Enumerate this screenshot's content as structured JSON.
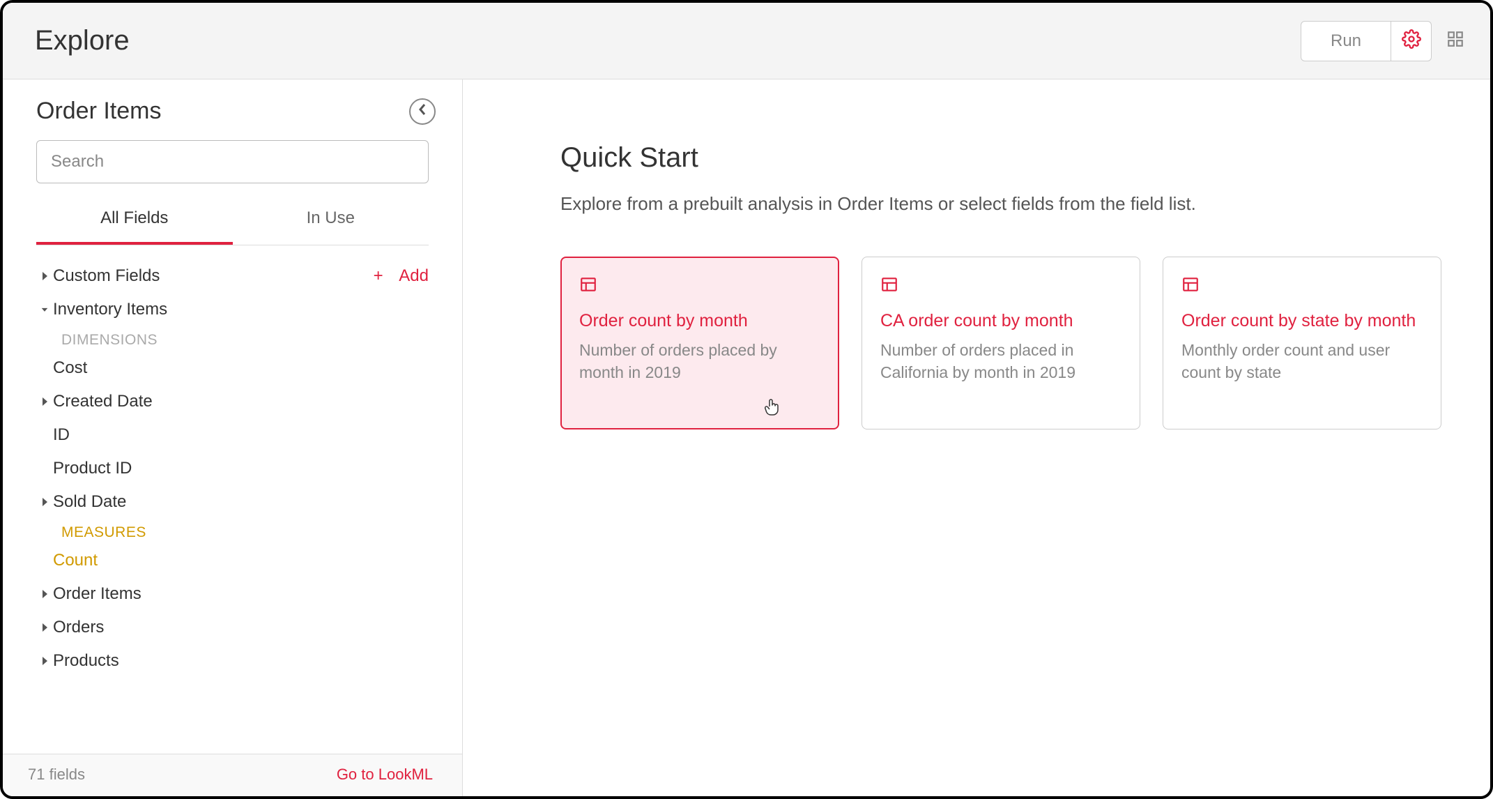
{
  "header": {
    "title": "Explore",
    "run": "Run"
  },
  "sidebar": {
    "title": "Order Items",
    "search_placeholder": "Search",
    "tabs": {
      "all": "All Fields",
      "inuse": "In Use"
    },
    "custom_fields": "Custom Fields",
    "add": "Add",
    "group_inventory": "Inventory Items",
    "dimensions_label": "DIMENSIONS",
    "dim_cost": "Cost",
    "dim_created": "Created Date",
    "dim_id": "ID",
    "dim_product_id": "Product ID",
    "dim_sold": "Sold Date",
    "measures_label": "MEASURES",
    "meas_count": "Count",
    "group_order_items": "Order Items",
    "group_orders": "Orders",
    "group_products": "Products",
    "footer_count": "71 fields",
    "footer_lookml": "Go to LookML"
  },
  "main": {
    "qs_title": "Quick Start",
    "qs_sub": "Explore from a prebuilt analysis in Order Items or select fields from the field list.",
    "cards": [
      {
        "title": "Order count by month",
        "desc": "Number of orders placed by month in 2019"
      },
      {
        "title": "CA order count by month",
        "desc": "Number of orders placed in California by month in 2019"
      },
      {
        "title": "Order count by state by month",
        "desc": "Monthly order count and user count by state"
      }
    ]
  }
}
